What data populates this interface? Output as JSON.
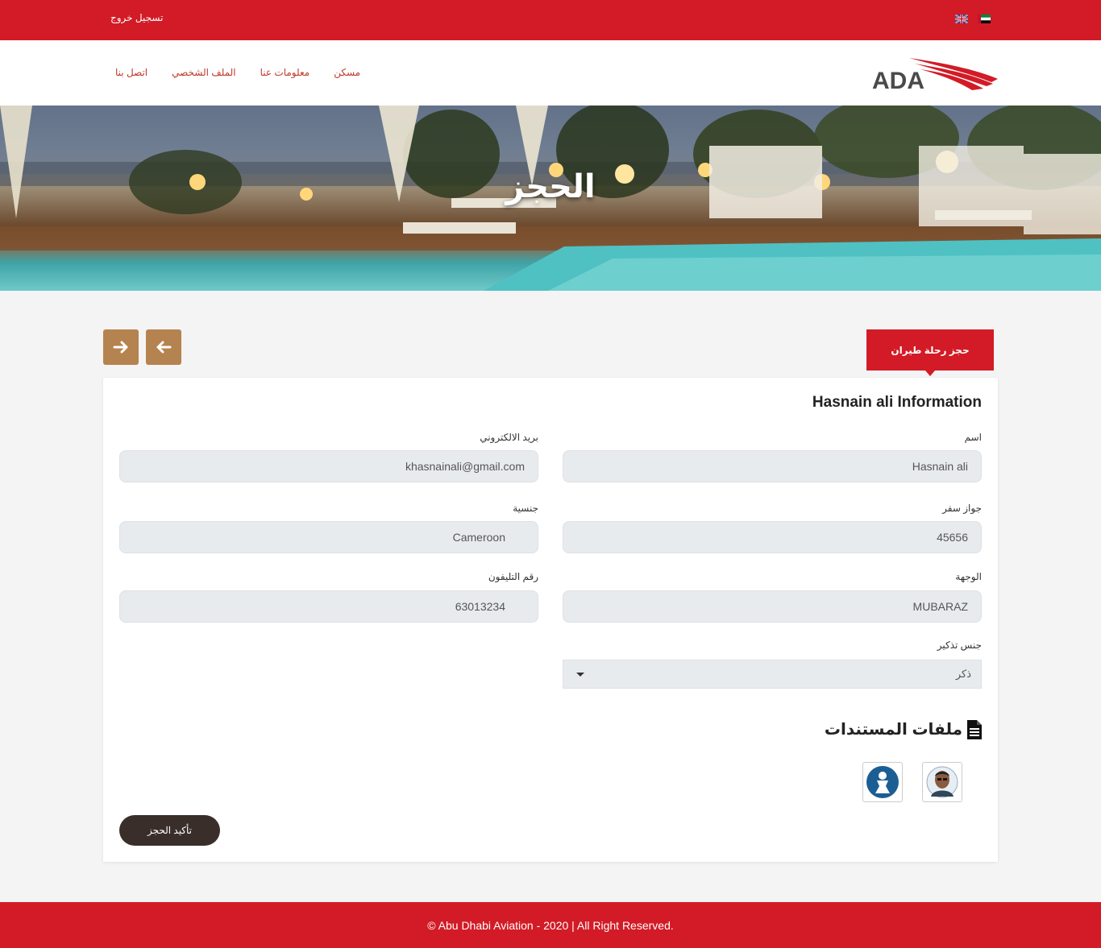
{
  "topbar": {
    "logout_label": "تسجيل خروج",
    "flags": [
      "uk-flag-icon",
      "uae-flag-icon"
    ]
  },
  "nav": {
    "links": [
      "مسكن",
      "معلومات عنا",
      "الملف الشخصي",
      "اتصل بنا"
    ]
  },
  "logo": {
    "text": "ADA"
  },
  "hero": {
    "title": "الحجز"
  },
  "tab": {
    "label": "حجز رحلة طيران"
  },
  "card": {
    "title": "Hasnain ali Information",
    "fields": {
      "name": {
        "label": "اسم",
        "value": "Hasnain ali"
      },
      "email": {
        "label": "بريد الالكتروني",
        "value": "khasnainali@gmail.com"
      },
      "passport": {
        "label": "جواز سفر",
        "value": "45656"
      },
      "nationality": {
        "label": "جنسية",
        "value": "Cameroon"
      },
      "destination": {
        "label": "الوجهة",
        "value": "MUBARAZ"
      },
      "phone": {
        "label": "رقم التليفون",
        "value": "63013234"
      },
      "gender": {
        "label": "جنس تذكير",
        "value": "ذكر"
      }
    },
    "documents_title": "ملفات المستندات",
    "confirm_label": "تأكيد الحجز"
  },
  "footer": {
    "text": "© Abu Dhabi Aviation - 2020 | All Right Reserved."
  },
  "colors": {
    "brand_red": "#d21b26",
    "accent_brown": "#b5834f",
    "dark_button": "#3a2e2b"
  }
}
